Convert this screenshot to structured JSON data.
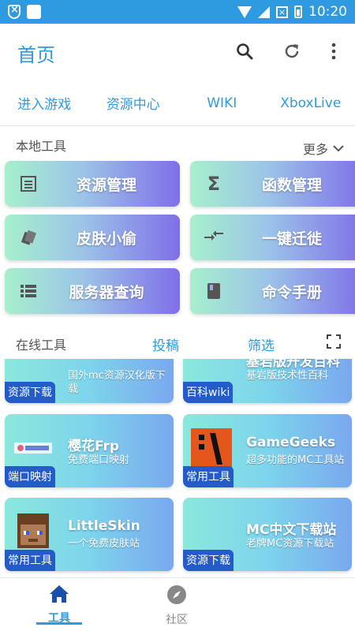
{
  "status": {
    "time": "10:20"
  },
  "header": {
    "title": "首页"
  },
  "tabs": [
    {
      "label": "进入游戏"
    },
    {
      "label": "资源中心"
    },
    {
      "label": "WIKI"
    },
    {
      "label": "XboxLive"
    }
  ],
  "local": {
    "label": "本地工具",
    "more": "更多",
    "tools": [
      {
        "label": "资源管理",
        "icon": "list-box-icon"
      },
      {
        "label": "函数管理",
        "icon": "sigma-icon"
      },
      {
        "label": "皮肤小偷",
        "icon": "cards-icon"
      },
      {
        "label": "一键迁徙",
        "icon": "arrows-in-icon"
      },
      {
        "label": "服务器查询",
        "icon": "list-icon"
      },
      {
        "label": "命令手册",
        "icon": "book-icon"
      }
    ]
  },
  "online": {
    "label": "在线工具",
    "submit": "投稿",
    "filter": "筛选",
    "cards": [
      {
        "name": "",
        "desc": "国外mc资源汉化版下载",
        "badge": "资源下载"
      },
      {
        "name": "基岩版开发百科",
        "desc": "基岩版技术性百科",
        "badge": "百科wiki"
      },
      {
        "name": "樱花Frp",
        "desc": "免费端口映射",
        "badge": "端口映射"
      },
      {
        "name": "GameGeeks",
        "desc": "超多功能的MC工具站",
        "badge": "常用工具"
      },
      {
        "name": "LittleSkin",
        "desc": "一个免费皮肤站",
        "badge": "常用工具"
      },
      {
        "name": "MC中文下载站",
        "desc": "老牌MC资源下载站",
        "badge": "资源下载"
      }
    ]
  },
  "bottom_nav": [
    {
      "label": "工具",
      "icon": "home-icon"
    },
    {
      "label": "社区",
      "icon": "compass-icon"
    }
  ],
  "colors": {
    "primary": "#2E9BE0",
    "badge": "#245BC9"
  }
}
